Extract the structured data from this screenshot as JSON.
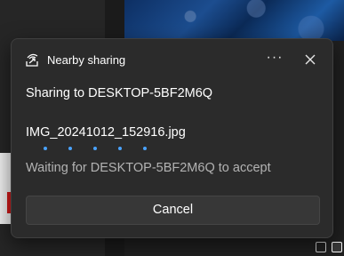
{
  "dialog": {
    "title": "Nearby sharing",
    "more_label": "···",
    "title_icon": "nearby-share-icon",
    "close_icon": "close-icon",
    "sharing_to": "Sharing to DESKTOP-5BF2M6Q",
    "file_name": "IMG_20241012_152916.jpg",
    "status": "Waiting for DESKTOP-5BF2M6Q to accept",
    "cancel_label": "Cancel",
    "accent_color": "#4aa3ff"
  }
}
